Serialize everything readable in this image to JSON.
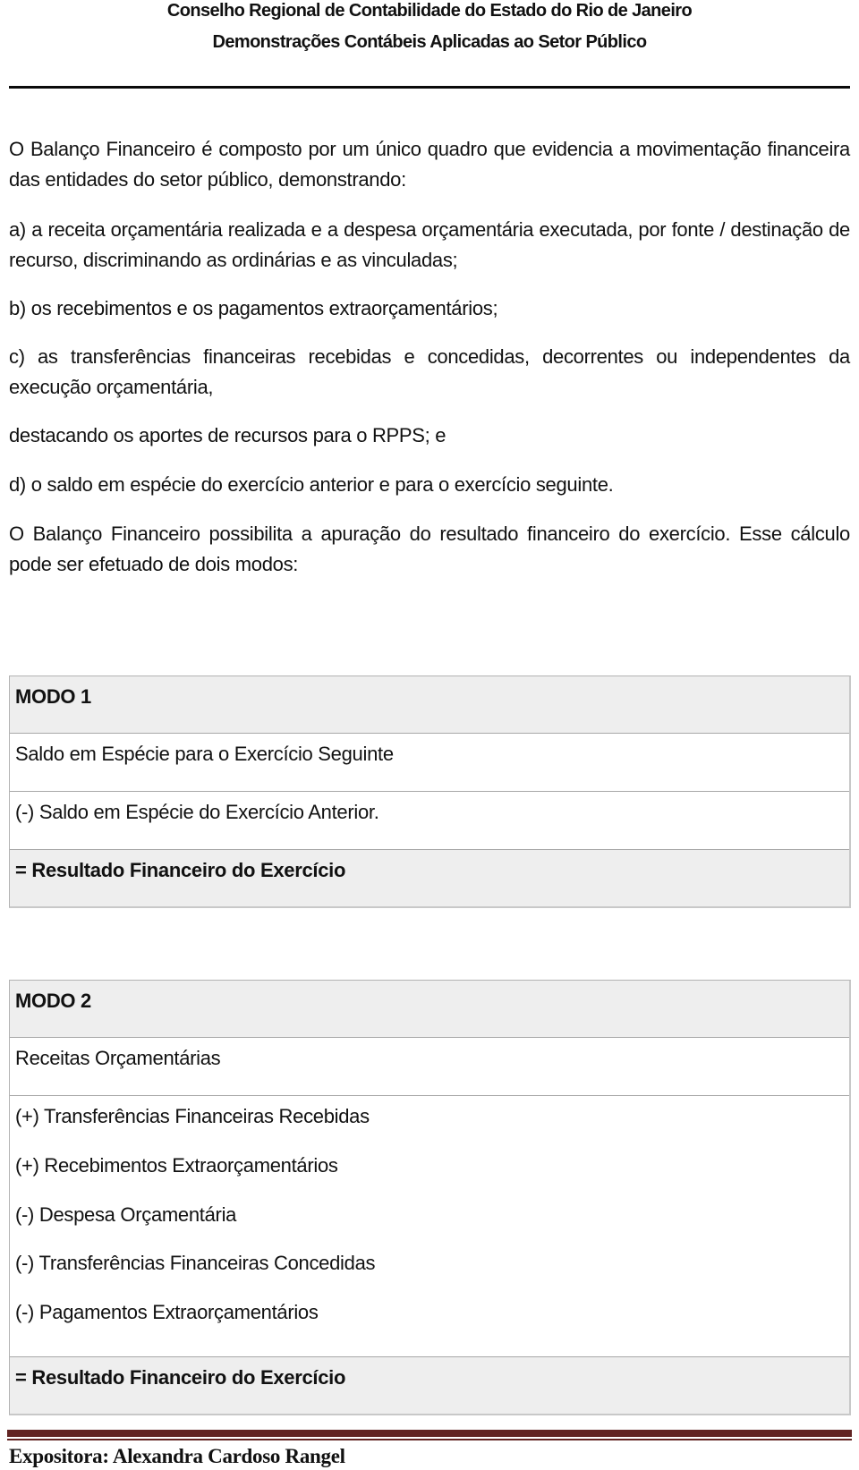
{
  "header": {
    "line1": "Conselho Regional de Contabilidade  do Estado do Rio de Janeiro",
    "line2": "Demonstrações Contábeis Aplicadas ao Setor Público"
  },
  "body": {
    "paragraphs": [
      "O Balanço Financeiro é composto por um único quadro que evidencia a movimentação financeira das entidades do setor público, demonstrando:",
      "a) a receita orçamentária realizada e a despesa orçamentária executada, por fonte / destinação de recurso,  discriminando as ordinárias e as vinculadas;",
      "b) os recebimentos e os pagamentos extraorçamentários;",
      "c) as transferências financeiras recebidas e concedidas, decorrentes ou independentes da execução orçamentária,",
      "destacando os aportes de recursos para o RPPS; e",
      "d) o saldo em espécie do exercício anterior e para o exercício seguinte.",
      "O Balanço Financeiro possibilita a apuração do resultado financeiro do exercício. Esse cálculo pode ser efetuado de dois modos:"
    ]
  },
  "modo1": {
    "title": "MODO 1",
    "rows": [
      "Saldo em Espécie para o Exercício Seguinte",
      "(-) Saldo em Espécie do Exercício Anterior."
    ],
    "result": "= Resultado Financeiro do Exercício"
  },
  "modo2": {
    "title": "MODO 2",
    "first_row": "Receitas Orçamentárias",
    "grouped_rows": [
      "(+) Transferências Financeiras Recebidas",
      "(+) Recebimentos Extraorçamentários",
      "(-) Despesa Orçamentária",
      "(-) Transferências Financeiras Concedidas",
      "(-) Pagamentos Extraorçamentários"
    ],
    "result": "= Resultado Financeiro do Exercício"
  },
  "footer": {
    "presenter": "Expositora: Alexandra Cardoso Rangel"
  },
  "colors": {
    "table_header_bg": "#eeeeee",
    "footer_rule": "#622423",
    "header_rule": "#0a0a0a"
  }
}
